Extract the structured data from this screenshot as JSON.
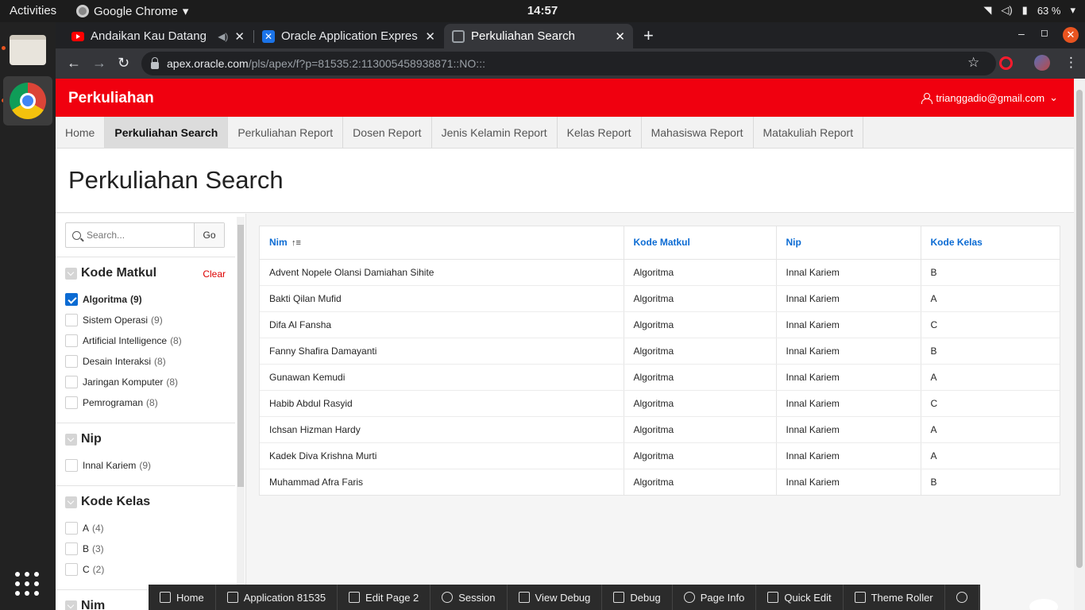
{
  "os": {
    "activities": "Activities",
    "app_name": "Google Chrome",
    "clock": "14:57",
    "battery": "63 %"
  },
  "tabs": [
    {
      "title": "Andaikan Kau Datang",
      "icon": "youtube-icon"
    },
    {
      "title": "Oracle Application Expres",
      "icon": "apex-icon"
    },
    {
      "title": "Perkuliahan Search",
      "icon": "page-icon"
    }
  ],
  "omnibox": {
    "host": "apex.oracle.com",
    "path": "/pls/apex/f?p=81535:2:113005458938871::NO:::"
  },
  "app": {
    "name": "Perkuliahan",
    "user": "trianggadio@gmail.com",
    "header_color": "#f0000f",
    "nav": [
      "Home",
      "Perkuliahan Search",
      "Perkuliahan Report",
      "Dosen Report",
      "Jenis Kelamin Report",
      "Kelas Report",
      "Mahasiswa Report",
      "Matakuliah Report"
    ],
    "page_title": "Perkuliahan Search"
  },
  "search": {
    "placeholder": "Search...",
    "go_label": "Go"
  },
  "facets": {
    "kode_matkul": {
      "title": "Kode Matkul",
      "clear": "Clear",
      "options": [
        {
          "label": "Algoritma",
          "count": "(9)",
          "checked": true
        },
        {
          "label": "Sistem Operasi",
          "count": "(9)"
        },
        {
          "label": "Artificial Intelligence",
          "count": "(8)"
        },
        {
          "label": "Desain Interaksi",
          "count": "(8)"
        },
        {
          "label": "Jaringan Komputer",
          "count": "(8)"
        },
        {
          "label": "Pemrograman",
          "count": "(8)"
        }
      ]
    },
    "nip": {
      "title": "Nip",
      "options": [
        {
          "label": "Innal Kariem",
          "count": "(9)"
        }
      ]
    },
    "kode_kelas": {
      "title": "Kode Kelas",
      "options": [
        {
          "label": "A",
          "count": "(4)"
        },
        {
          "label": "B",
          "count": "(3)"
        },
        {
          "label": "C",
          "count": "(2)"
        }
      ]
    },
    "nim": {
      "title": "Nim"
    }
  },
  "report": {
    "columns": [
      "Nim",
      "Kode Matkul",
      "Nip",
      "Kode Kelas"
    ],
    "sort_indicator": "↑≡",
    "rows": [
      [
        "Advent Nopele Olansi Damiahan Sihite",
        "Algoritma",
        "Innal Kariem",
        "B"
      ],
      [
        "Bakti Qilan Mufid",
        "Algoritma",
        "Innal Kariem",
        "A"
      ],
      [
        "Difa Al Fansha",
        "Algoritma",
        "Innal Kariem",
        "C"
      ],
      [
        "Fanny Shafira Damayanti",
        "Algoritma",
        "Innal Kariem",
        "B"
      ],
      [
        "Gunawan Kemudi",
        "Algoritma",
        "Innal Kariem",
        "A"
      ],
      [
        "Habib Abdul Rasyid",
        "Algoritma",
        "Innal Kariem",
        "C"
      ],
      [
        "Ichsan Hizman Hardy",
        "Algoritma",
        "Innal Kariem",
        "A"
      ],
      [
        "Kadek Diva Krishna Murti",
        "Algoritma",
        "Innal Kariem",
        "A"
      ],
      [
        "Muhammad Afra Faris",
        "Algoritma",
        "Innal Kariem",
        "B"
      ]
    ]
  },
  "devbar": [
    {
      "label": "Home",
      "icon": "home-icon"
    },
    {
      "label": "Application 81535",
      "icon": "edit-icon"
    },
    {
      "label": "Edit Page 2",
      "icon": "pencil-icon"
    },
    {
      "label": "Session",
      "icon": "clock-icon"
    },
    {
      "label": "View Debug",
      "icon": "debug-view-icon"
    },
    {
      "label": "Debug",
      "icon": "bug-icon"
    },
    {
      "label": "Page Info",
      "icon": "info-icon"
    },
    {
      "label": "Quick Edit",
      "icon": "quick-edit-icon"
    },
    {
      "label": "Theme Roller",
      "icon": "paint-roller-icon"
    },
    {
      "label": "",
      "icon": "settings-gear-icon"
    }
  ]
}
